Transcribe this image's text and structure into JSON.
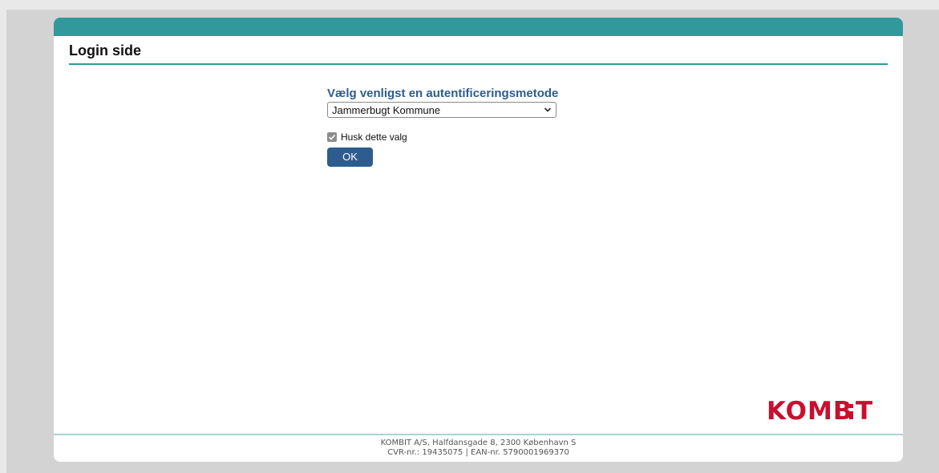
{
  "page": {
    "title": "Login side"
  },
  "form": {
    "heading": "Vælg venligst en autentificeringsmetode",
    "selected_method": "Jammerbugt Kommune",
    "remember_label": "Husk dette valg",
    "remember_checked": true,
    "ok_label": "OK"
  },
  "logo": {
    "text": "KOMBIT"
  },
  "footer": {
    "line1": "KOMBIT A/S, Halfdansgade 8, 2300 København S",
    "line2": "CVR-nr.: 19435075 | EAN-nr. 5790001969370"
  },
  "colors": {
    "accent": "#31989c",
    "heading": "#2e5c8f",
    "button": "#2e5c8f",
    "logo": "#c8102e"
  }
}
